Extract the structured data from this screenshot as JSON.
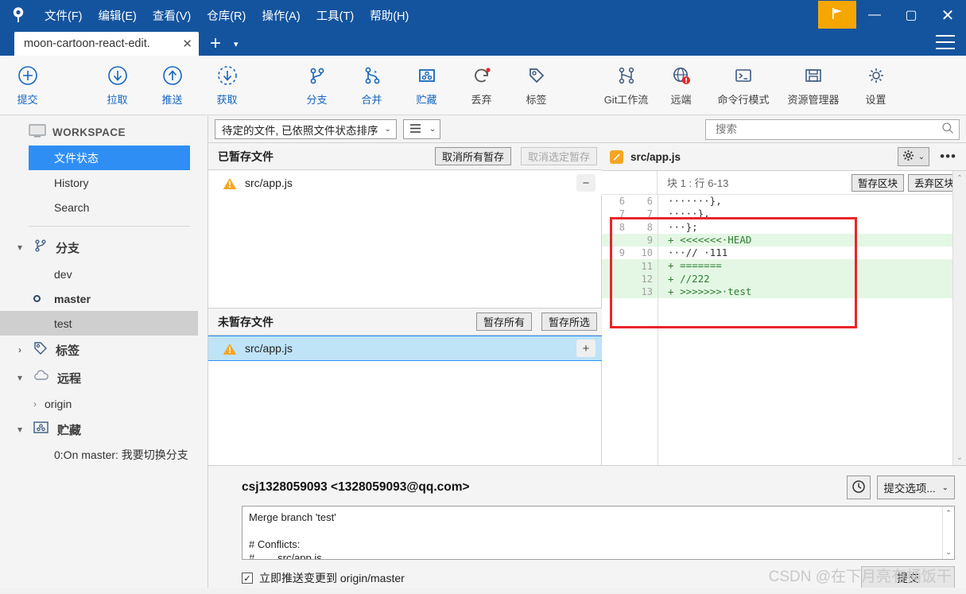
{
  "titlebar": {
    "app_icon": "sourcetree-logo-icon",
    "menus": [
      "文件(F)",
      "编辑(E)",
      "查看(V)",
      "仓库(R)",
      "操作(A)",
      "工具(T)",
      "帮助(H)"
    ],
    "flag_button": "flag-icon",
    "minimize": "—",
    "maximize": "▢",
    "close": "✕",
    "accent": "#14549e",
    "flag_color": "#f5a600"
  },
  "tabs": {
    "items": [
      {
        "title": "moon-cartoon-react-edit.",
        "close": "✕"
      }
    ],
    "add": "+",
    "caret": "▾"
  },
  "toolbar": {
    "items": [
      {
        "label": "提交",
        "icon": "plus-circle-icon",
        "color": "#1565c0"
      },
      {
        "label": "拉取",
        "icon": "arrow-down-circle-icon",
        "color": "#1565c0"
      },
      {
        "label": "推送",
        "icon": "arrow-up-circle-icon",
        "color": "#1565c0"
      },
      {
        "label": "获取",
        "icon": "arrow-down-dashed-circle-icon",
        "color": "#1565c0"
      },
      {
        "label": "分支",
        "icon": "branch-icon",
        "color": "#1565c0"
      },
      {
        "label": "合并",
        "icon": "merge-icon",
        "color": "#1565c0"
      },
      {
        "label": "贮藏",
        "icon": "stash-icon",
        "color": "#1565c0"
      },
      {
        "label": "丢弃",
        "icon": "discard-refresh-icon",
        "color": "#555555"
      },
      {
        "label": "标签",
        "icon": "tag-icon",
        "color": "#555555"
      },
      {
        "label": "Git工作流",
        "icon": "gitflow-icon",
        "color": "#555555"
      },
      {
        "label": "远端",
        "icon": "globe-alert-icon",
        "color": "#555555"
      },
      {
        "label": "命令行模式",
        "icon": "terminal-icon",
        "color": "#555555"
      },
      {
        "label": "资源管理器",
        "icon": "folder-icon",
        "color": "#555555"
      },
      {
        "label": "设置",
        "icon": "gear-icon",
        "color": "#555555"
      }
    ]
  },
  "sidebar": {
    "workspace_label": "WORKSPACE",
    "workspace_icon": "monitor-icon",
    "workspace_items": [
      {
        "label": "文件状态",
        "selected": true
      },
      {
        "label": "History",
        "selected": false
      },
      {
        "label": "Search",
        "selected": false
      }
    ],
    "groups": [
      {
        "label": "分支",
        "icon": "branch-icon",
        "twisty": "▾",
        "children": [
          {
            "label": "dev",
            "current": false,
            "highlight": false,
            "twisty": ""
          },
          {
            "label": "master",
            "current": true,
            "highlight": false,
            "twisty": ""
          },
          {
            "label": "test",
            "current": false,
            "highlight": true,
            "twisty": ""
          }
        ]
      },
      {
        "label": "标签",
        "icon": "tag-icon",
        "twisty": "›",
        "children": []
      },
      {
        "label": "远程",
        "icon": "cloud-icon",
        "twisty": "▾",
        "children": [
          {
            "label": "origin",
            "current": false,
            "highlight": false,
            "twisty": "›"
          }
        ]
      },
      {
        "label": "贮藏",
        "icon": "stash-icon",
        "twisty": "▾",
        "children": []
      }
    ],
    "stash_entry": "0:On master: 我要切换分支",
    "selection_color": "#2f8ef4"
  },
  "filterbar": {
    "sort_value": "待定的文件, 已依照文件状态排序",
    "sort_caret": "⌄",
    "view_icon": "list-view-icon",
    "view_caret": "⌄",
    "search_placeholder": "搜索",
    "search_value": "",
    "search_icon": "search-icon"
  },
  "staged": {
    "title": "已暂存文件",
    "unstage_all": "取消所有暂存",
    "unstage_selected": "取消选定暂存",
    "rows": [
      {
        "name": "src/app.js",
        "status_icon": "warning-triangle-icon",
        "action": "−",
        "selected": false
      }
    ]
  },
  "unstaged": {
    "title": "未暂存文件",
    "stage_all": "暂存所有",
    "stage_selected": "暂存所选",
    "rows": [
      {
        "name": "src/app.js",
        "status_icon": "warning-triangle-icon",
        "action": "+",
        "selected": true
      }
    ]
  },
  "diff": {
    "file": "src/app.js",
    "file_icon": "edit-pencil-icon",
    "gear_icon": "gear-icon",
    "gear_caret": "⌄",
    "more_icon": "ellipsis-icon",
    "hunk_label": "块 1 :  行 6-13",
    "stage_hunk": "暂存区块",
    "discard_hunk": "丢弃区块",
    "lines": [
      {
        "old": "6",
        "new": "6",
        "marker": "",
        "text": "·······},",
        "type": "ctx"
      },
      {
        "old": "7",
        "new": "7",
        "marker": "",
        "text": "·····},",
        "type": "ctx"
      },
      {
        "old": "8",
        "new": "8",
        "marker": "",
        "text": "···};",
        "type": "ctx"
      },
      {
        "old": "",
        "new": "9",
        "marker": "+",
        "text": "<<<<<<<·HEAD",
        "type": "add"
      },
      {
        "old": "9",
        "new": "10",
        "marker": "",
        "text": "···// ·111",
        "type": "ctx"
      },
      {
        "old": "",
        "new": "11",
        "marker": "+",
        "text": "=======",
        "type": "add"
      },
      {
        "old": "",
        "new": "12",
        "marker": "+",
        "text": "//222",
        "type": "add"
      },
      {
        "old": "",
        "new": "13",
        "marker": "+",
        "text": ">>>>>>>·test",
        "type": "add"
      }
    ],
    "add_bg": "#e4f7e4",
    "annotation_color": "#e8262a"
  },
  "commit": {
    "author": "csj1328059093 <1328059093@qq.com>",
    "clock_icon": "history-clock-icon",
    "options_label": "提交选项...",
    "options_caret": "⌄",
    "message": "Merge branch 'test'\n\n# Conflicts:\n#        src/app.js",
    "push_checkbox_label": "立即推送变更到 origin/master",
    "push_checked": true,
    "check_glyph": "✓",
    "commit_button": "提交",
    "watermark": "CSDN @在下月亮有桶饭干"
  }
}
